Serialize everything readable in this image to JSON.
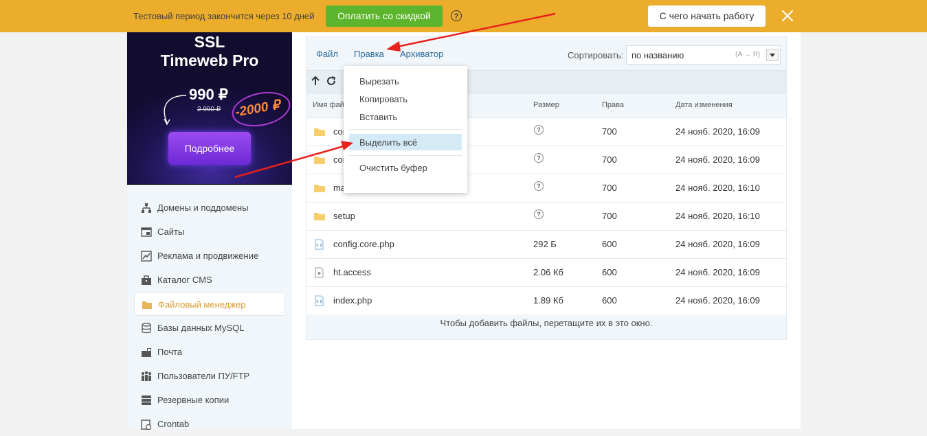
{
  "topbar": {
    "trial_text": "Тестовый период закончится через 10 дней",
    "pay_button": "Оплатить со скидкой",
    "help_icon": "?",
    "start_button": "С чего начать работу",
    "close_icon": "close-icon"
  },
  "banner": {
    "title_line1": "SSL",
    "title_line2": "Timeweb Pro",
    "price": "990 ₽",
    "old_price": "2 990 ₽",
    "discount": "-2000 ₽",
    "button": "Подробнее"
  },
  "sidebar": {
    "items": [
      {
        "label": "Домены и поддомены",
        "icon": "sitemap-icon"
      },
      {
        "label": "Сайты",
        "icon": "site-icon"
      },
      {
        "label": "Реклама и продвижение",
        "icon": "chart-icon"
      },
      {
        "label": "Каталог CMS",
        "icon": "briefcase-icon"
      },
      {
        "label": "Файловый менеджер",
        "icon": "folder-icon",
        "active": true
      },
      {
        "label": "Базы данных MySQL",
        "icon": "database-icon"
      },
      {
        "label": "Почта",
        "icon": "mail-icon"
      },
      {
        "label": "Пользователи ПУ/FTP",
        "icon": "users-icon"
      },
      {
        "label": "Резервные копии",
        "icon": "server-icon"
      },
      {
        "label": "Crontab",
        "icon": "clock-icon"
      }
    ]
  },
  "filemanager": {
    "menu": {
      "file": "Файл",
      "edit": "Правка",
      "archiver": "Архиватор"
    },
    "sort_label": "Сортировать:",
    "sort_value": "по названию",
    "sort_hint": "(А → Я)",
    "columns": {
      "name": "Имя файла",
      "size": "Размер",
      "perms": "Права",
      "date": "Дата изменения"
    },
    "rows": [
      {
        "name": "config",
        "type": "folder",
        "size": "?",
        "perms": "700",
        "date": "24 нояб. 2020, 16:09"
      },
      {
        "name": "connectors",
        "type": "folder",
        "size": "?",
        "perms": "700",
        "date": "24 нояб. 2020, 16:09"
      },
      {
        "name": "manager",
        "type": "folder",
        "size": "?",
        "perms": "700",
        "date": "24 нояб. 2020, 16:10"
      },
      {
        "name": "setup",
        "type": "folder",
        "size": "?",
        "perms": "700",
        "date": "24 нояб. 2020, 16:10"
      },
      {
        "name": "config.core.php",
        "type": "code",
        "size": "292 Б",
        "perms": "600",
        "date": "24 нояб. 2020, 16:09"
      },
      {
        "name": "ht.access",
        "type": "file",
        "size": "2.06 Кб",
        "perms": "600",
        "date": "24 нояб. 2020, 16:09"
      },
      {
        "name": "index.php",
        "type": "code",
        "size": "1.89 Кб",
        "perms": "600",
        "date": "24 нояб. 2020, 16:09"
      }
    ],
    "drop_hint": "Чтобы добавить файлы, перетащите их в это окно."
  },
  "edit_menu": {
    "items": [
      "Вырезать",
      "Копировать",
      "Вставить",
      "Выделить всё",
      "Очистить буфер"
    ],
    "highlighted": "Выделить всё"
  },
  "colors": {
    "topbar": "#ecac2c",
    "pay_button": "#5cb52c",
    "active_menu": "#d99a2a",
    "annotation_arrow": "#e8201c"
  }
}
